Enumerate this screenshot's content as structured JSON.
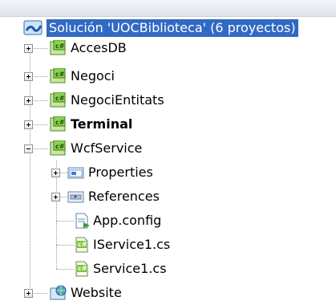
{
  "solution": {
    "label": "Solución 'UOCBiblioteca' (6 proyectos)"
  },
  "projects": {
    "accesdb": {
      "label": "AccesDB",
      "icon": "csharp-project-icon"
    },
    "negoci": {
      "label": "Negoci",
      "icon": "csharp-project-icon"
    },
    "negocientitats": {
      "label": "NegociEntitats",
      "icon": "csharp-project-icon"
    },
    "terminal": {
      "label": "Terminal",
      "icon": "csharp-project-icon"
    },
    "wcfservice": {
      "label": "WcfService",
      "icon": "csharp-project-icon",
      "children": {
        "properties": {
          "label": "Properties",
          "icon": "properties-folder-icon"
        },
        "references": {
          "label": "References",
          "icon": "references-folder-icon"
        },
        "appconfig": {
          "label": "App.config",
          "icon": "config-file-icon"
        },
        "iservice1": {
          "label": "IService1.cs",
          "icon": "csharp-file-icon"
        },
        "service1": {
          "label": "Service1.cs",
          "icon": "csharp-file-icon"
        }
      }
    },
    "website": {
      "label": "Website",
      "icon": "website-project-icon"
    }
  },
  "colors": {
    "selection": "#316ac5",
    "csharp": "#2f8d2f"
  }
}
